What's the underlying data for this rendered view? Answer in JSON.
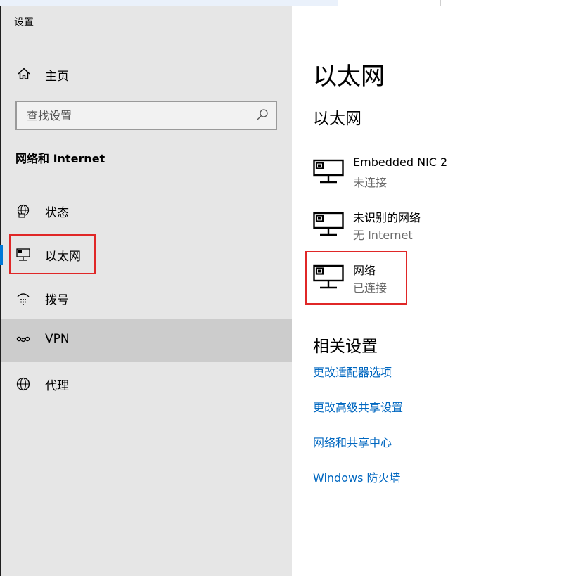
{
  "window": {
    "app_title": "设置"
  },
  "sidebar": {
    "home_label": "主页",
    "search_placeholder": "查找设置",
    "section_title": "网络和 Internet",
    "items": [
      {
        "label": "状态",
        "icon": "globe-status-icon"
      },
      {
        "label": "以太网",
        "icon": "ethernet-icon",
        "selected": true
      },
      {
        "label": "拨号",
        "icon": "dialup-icon"
      },
      {
        "label": "VPN",
        "icon": "vpn-icon",
        "hovered": true
      },
      {
        "label": "代理",
        "icon": "globe-icon"
      }
    ]
  },
  "main": {
    "page_title": "以太网",
    "subheading": "以太网",
    "networks": [
      {
        "name": "Embedded NIC 2",
        "status": "未连接"
      },
      {
        "name": "未识别的网络",
        "status": "无 Internet"
      },
      {
        "name": "网络",
        "status": "已连接"
      }
    ],
    "related_title": "相关设置",
    "related_links": [
      "更改适配器选项",
      "更改高级共享设置",
      "网络和共享中心",
      "Windows 防火墙"
    ]
  },
  "colors": {
    "accent": "#0078d7",
    "link": "#0067c0",
    "sidebar_bg": "#e6e6e6",
    "highlight_box": "#e02727"
  }
}
